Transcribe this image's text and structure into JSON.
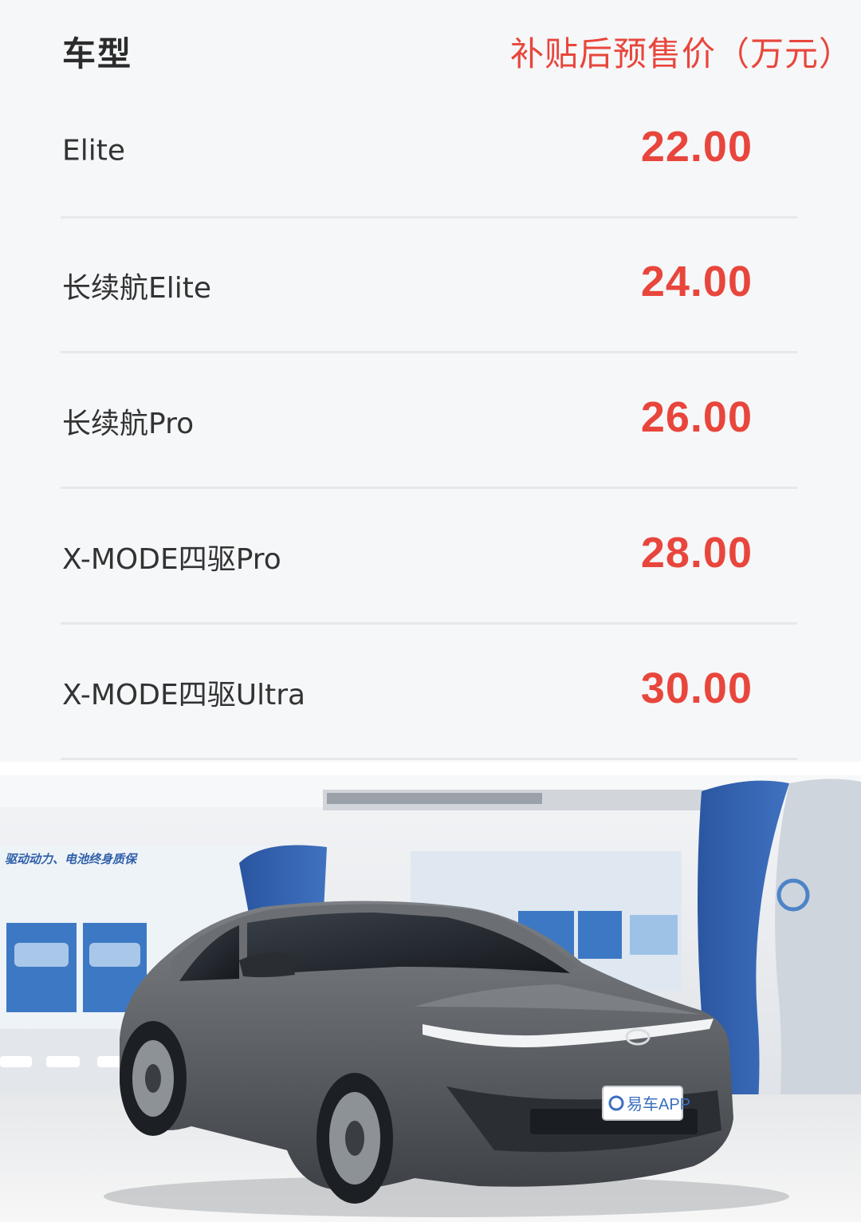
{
  "header": {
    "model_label": "车型",
    "price_label": "补贴后预售价（万元）"
  },
  "rows": [
    {
      "name": "Elite",
      "price": "22.00"
    },
    {
      "name": "长续航Elite",
      "price": "24.00"
    },
    {
      "name": "长续航Pro",
      "price": "26.00"
    },
    {
      "name": "X-MODE四驱Pro",
      "price": "28.00"
    },
    {
      "name": "X-MODE四驱Ultra",
      "price": "30.00"
    }
  ],
  "photo": {
    "watermark_text": "易车APP",
    "banner_text": "驱动动力、电池终身质保",
    "colors": {
      "accent_red": "#e8463c",
      "showroom_blue": "#2f5fa8",
      "car_gray": "#5e6266"
    }
  }
}
